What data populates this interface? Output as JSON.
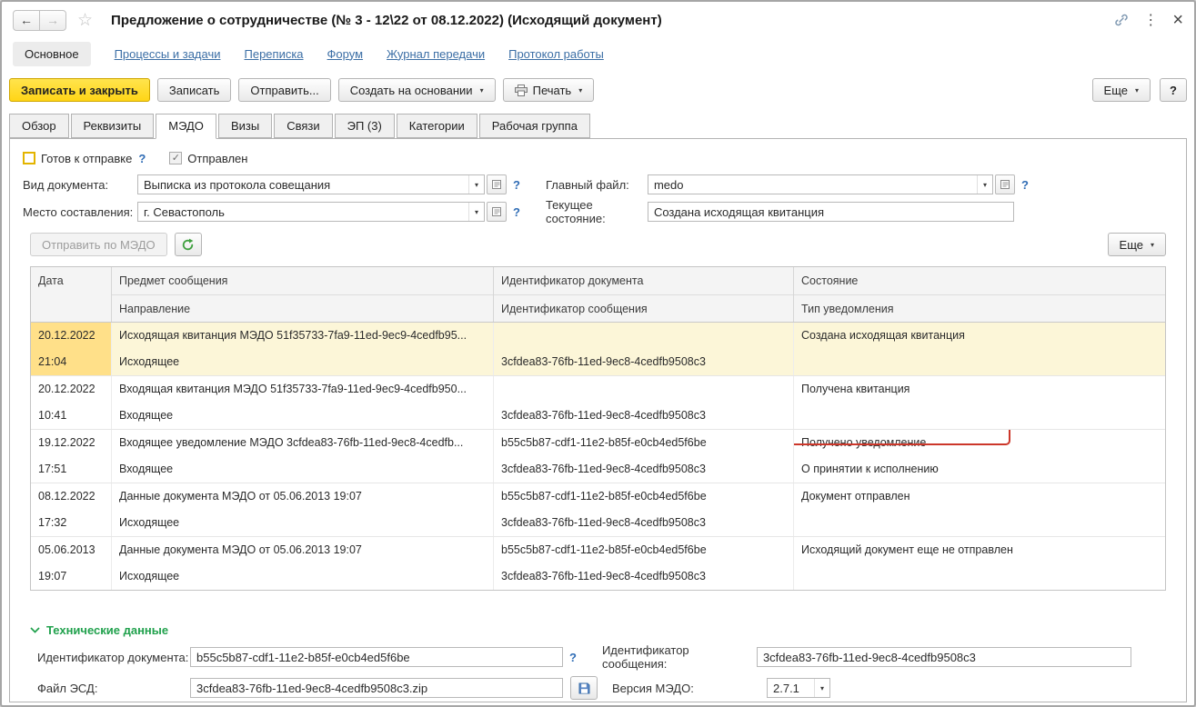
{
  "colors": {
    "accent_yellow": "#ffd516",
    "link_blue": "#3b6ea5",
    "section_green": "#21a14d",
    "annotation_red": "#cc372a",
    "selected_row_bg": "#fcf6d8",
    "selected_cell_bg": "#ffe089"
  },
  "icons": {
    "back": "←",
    "forward": "→",
    "star": "☆",
    "dots": "⋮",
    "close": "×",
    "caret": "▾",
    "check": "✓",
    "help": "?"
  },
  "window": {
    "title": "Предложение о сотрудничестве (№ 3 - 12\\22 от 08.12.2022) (Исходящий документ)"
  },
  "nav": {
    "active": "Основное",
    "links": [
      "Процессы и задачи",
      "Переписка",
      "Форум",
      "Журнал передачи",
      "Протокол работы"
    ]
  },
  "toolbar": {
    "save_close": "Записать и закрыть",
    "save": "Записать",
    "send": "Отправить...",
    "create_based": "Создать на основании",
    "print": "Печать",
    "more": "Еще",
    "help": "?"
  },
  "tabs": {
    "items": [
      "Обзор",
      "Реквизиты",
      "МЭДО",
      "Визы",
      "Связи",
      "ЭП (3)",
      "Категории",
      "Рабочая группа"
    ],
    "active": "МЭДО"
  },
  "medo": {
    "ready_label": "Готов к отправке",
    "sent_label": "Отправлен",
    "doc_type_label": "Вид документа:",
    "doc_type_value": "Выписка из протокола совещания",
    "main_file_label": "Главный файл:",
    "main_file_value": "medo",
    "place_label": "Место составления:",
    "place_value": "г. Севастополь",
    "state_label": "Текущее состояние:",
    "state_value": "Создана исходящая квитанция",
    "send_medo": "Отправить по МЭДО",
    "more": "Еще"
  },
  "table": {
    "headers": {
      "date": "Дата",
      "subject": "Предмет сообщения",
      "direction": "Направление",
      "doc_id": "Идентификатор документа",
      "msg_id": "Идентификатор сообщения",
      "state": "Состояние",
      "notif_type": "Тип уведомления"
    },
    "rows": [
      {
        "date": "20.12.2022",
        "time": "21:04",
        "subject": "Исходящая квитанция МЭДО 51f35733-7fa9-11ed-9ec9-4cedfb95...",
        "direction": "Исходящее",
        "doc_id": "",
        "msg_id": "3cfdea83-76fb-11ed-9ec8-4cedfb9508c3",
        "state": "Создана исходящая квитанция",
        "notif": ""
      },
      {
        "date": "20.12.2022",
        "time": "10:41",
        "subject": "Входящая квитанция МЭДО 51f35733-7fa9-11ed-9ec9-4cedfb950...",
        "direction": "Входящее",
        "doc_id": "",
        "msg_id": "3cfdea83-76fb-11ed-9ec8-4cedfb9508c3",
        "state": "Получена квитанция",
        "notif": ""
      },
      {
        "date": "19.12.2022",
        "time": "17:51",
        "subject": "Входящее уведомление МЭДО 3cfdea83-76fb-11ed-9ec8-4cedfb...",
        "direction": "Входящее",
        "doc_id": "b55c5b87-cdf1-11e2-b85f-e0cb4ed5f6be",
        "msg_id": "3cfdea83-76fb-11ed-9ec8-4cedfb9508c3",
        "state": "Получено уведомление",
        "notif": "О принятии к исполнению"
      },
      {
        "date": "08.12.2022",
        "time": "17:32",
        "subject": "Данные документа МЭДО от 05.06.2013 19:07",
        "direction": "Исходящее",
        "doc_id": "b55c5b87-cdf1-11e2-b85f-e0cb4ed5f6be",
        "msg_id": "3cfdea83-76fb-11ed-9ec8-4cedfb9508c3",
        "state": "Документ отправлен",
        "notif": ""
      },
      {
        "date": "05.06.2013",
        "time": "19:07",
        "subject": "Данные документа МЭДО от 05.06.2013 19:07",
        "direction": "Исходящее",
        "doc_id": "b55c5b87-cdf1-11e2-b85f-e0cb4ed5f6be",
        "msg_id": "3cfdea83-76fb-11ed-9ec8-4cedfb9508c3",
        "state": "Исходящий документ еще не отправлен",
        "notif": ""
      }
    ]
  },
  "tech": {
    "title": "Технические данные",
    "doc_id_label": "Идентификатор документа:",
    "doc_id_value": "b55c5b87-cdf1-11e2-b85f-e0cb4ed5f6be",
    "msg_id_label": "Идентификатор сообщения:",
    "msg_id_value": "3cfdea83-76fb-11ed-9ec8-4cedfb9508c3",
    "esd_label": "Файл ЭСД:",
    "esd_value": "3cfdea83-76fb-11ed-9ec8-4cedfb9508c3.zip",
    "version_label": "Версия МЭДО:",
    "version_value": "2.7.1"
  }
}
